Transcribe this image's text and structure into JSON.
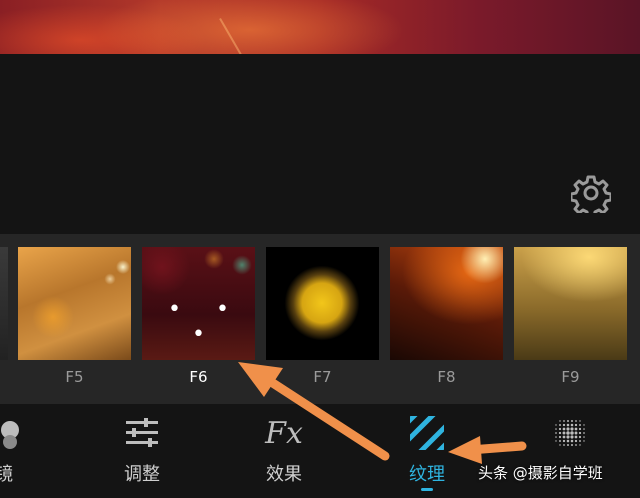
{
  "filters": [
    {
      "id": "F5",
      "label": "F5",
      "active": false
    },
    {
      "id": "F6",
      "label": "F6",
      "active": true
    },
    {
      "id": "F7",
      "label": "F7",
      "active": false
    },
    {
      "id": "F8",
      "label": "F8",
      "active": false
    },
    {
      "id": "F9",
      "label": "F9",
      "active": false
    }
  ],
  "selected_overlay": "• • •",
  "tabs": [
    {
      "label": "镜",
      "icon": "lens-icon"
    },
    {
      "label": "调整",
      "icon": "sliders-icon"
    },
    {
      "label": "效果",
      "icon": "fx-icon",
      "icon_text": "Fx"
    },
    {
      "label": "纹理",
      "icon": "texture-stripes-icon",
      "active": true
    },
    {
      "label": "",
      "icon": "halftone-dots-icon"
    }
  ],
  "watermark": "头条 @摄影自学班",
  "colors": {
    "accent": "#2fb4e0",
    "arrow": "#f0904a",
    "panel": "#262626",
    "background": "#141414"
  },
  "icons": {
    "settings": "gear-icon"
  }
}
